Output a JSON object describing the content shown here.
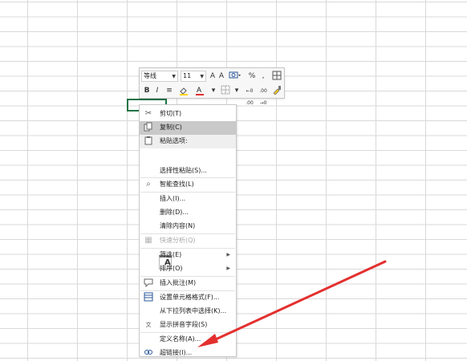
{
  "mini_toolbar": {
    "font_name": "等线",
    "font_size": "11",
    "percent": "%",
    "comma": "ɵʔ",
    "increase_font": "A",
    "decrease_font": "A",
    "bold": "B",
    "italic": "I",
    "align": "≡",
    "font_color": "A"
  },
  "context_menu": {
    "cut": "剪切(T)",
    "copy": "复制(C)",
    "paste_header": "粘贴选项:",
    "paste_special": "选择性粘贴(S)...",
    "smart_lookup": "智能查找(L)",
    "insert": "插入(I)...",
    "delete": "删除(D)...",
    "clear_contents": "清除内容(N)",
    "quick_analysis": "快速分析(Q)",
    "filter": "筛选(E)",
    "sort": "排序(O)",
    "insert_comment": "插入批注(M)",
    "format_cells": "设置单元格格式(F)...",
    "pick_from_list": "从下拉列表中选择(K)...",
    "show_phonetic": "显示拼音字段(S)",
    "define_name": "定义名称(A)...",
    "hyperlink": "超链接(I)..."
  },
  "colors": {
    "selected_cell_border": "#217346",
    "arrow": "#e3302f",
    "highlight": "#c9c9c9"
  },
  "icons": {
    "cut": "scissors-icon",
    "copy": "copy-icon",
    "paste": "clipboard-icon",
    "smart_lookup": "search-icon",
    "quick_analysis": "chart-icon",
    "insert_comment": "comment-icon",
    "format_cells": "format-cells-icon",
    "show_phonetic": "phonetic-icon",
    "hyperlink": "link-icon",
    "paste_option": "paste-text-icon"
  }
}
